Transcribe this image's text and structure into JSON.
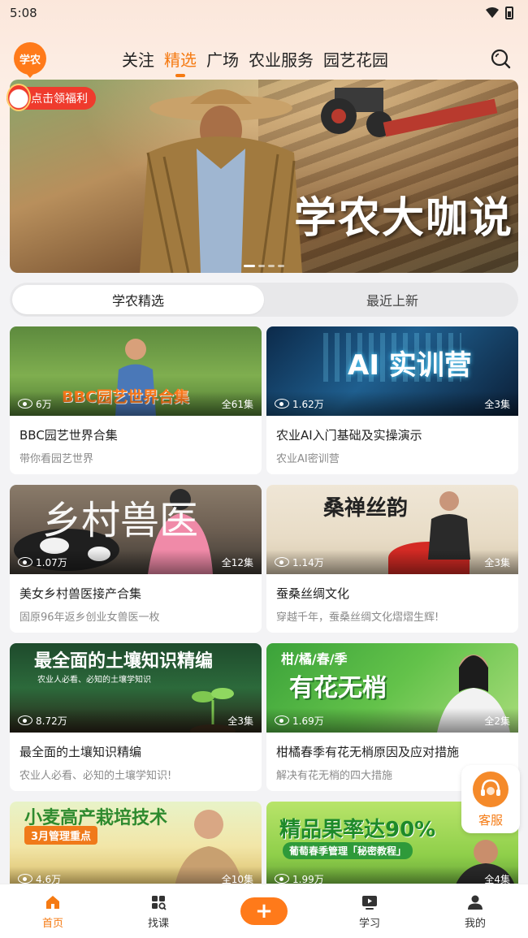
{
  "status_bar": {
    "time": "5:08"
  },
  "header": {
    "logo_text": "学农",
    "tabs": [
      {
        "label": "关注"
      },
      {
        "label": "精选",
        "active": true
      },
      {
        "label": "广场"
      },
      {
        "label": "农业服务"
      },
      {
        "label": "园艺花园"
      }
    ]
  },
  "banner": {
    "title": "学农大咖说",
    "promo_label": "点击领福利"
  },
  "segment": {
    "options": [
      {
        "label": "学农精选",
        "active": true
      },
      {
        "label": "最近上新"
      }
    ]
  },
  "cards": [
    {
      "thumb_text": "BBC园艺世界合集",
      "views": "6万",
      "episodes": "全61集",
      "title": "BBC园艺世界合集",
      "subtitle": "带你看园艺世界"
    },
    {
      "thumb_text": "AI 实训营",
      "views": "1.62万",
      "episodes": "全3集",
      "title": "农业AI入门基础及实操演示",
      "subtitle": "农业AI密训营"
    },
    {
      "thumb_text": "乡村兽医",
      "views": "1.07万",
      "episodes": "全12集",
      "title": "美女乡村兽医接产合集",
      "subtitle": "固原96年返乡创业女兽医一枚"
    },
    {
      "thumb_text": "桑禅丝韵",
      "views": "1.14万",
      "episodes": "全3集",
      "title": "蚕桑丝绸文化",
      "subtitle": "穿越千年，蚕桑丝绸文化熠熠生辉!"
    },
    {
      "thumb_text": "最全面的土壤知识精编",
      "thumb_sub": "农业人必看、必知的土壤学知识",
      "views": "8.72万",
      "episodes": "全3集",
      "title": "最全面的土壤知识精编",
      "subtitle": "农业人必看、必知的土壤学知识!"
    },
    {
      "thumb_text": "有花无梢",
      "thumb_sub": "柑/橘/春/季",
      "views": "1.69万",
      "episodes": "全2集",
      "title": "柑橘春季有花无梢原因及应对措施",
      "subtitle": "解决有花无梢的四大措施"
    },
    {
      "thumb_text": "小麦高产栽培技术",
      "thumb_sub": "3月管理重点",
      "views": "4.6万",
      "episodes": "全10集"
    },
    {
      "thumb_text": "精品果率达90%",
      "thumb_sub": "葡萄春季管理「秘密教程」",
      "views": "1.99万",
      "episodes": "全4集"
    }
  ],
  "service": {
    "label": "客服"
  },
  "bottom_nav": [
    {
      "label": "首页",
      "active": true
    },
    {
      "label": "找课"
    },
    {
      "label": "+"
    },
    {
      "label": "学习"
    },
    {
      "label": "我的"
    }
  ],
  "colors": {
    "accent": "#f57a12",
    "promo": "#ef3b2d"
  }
}
